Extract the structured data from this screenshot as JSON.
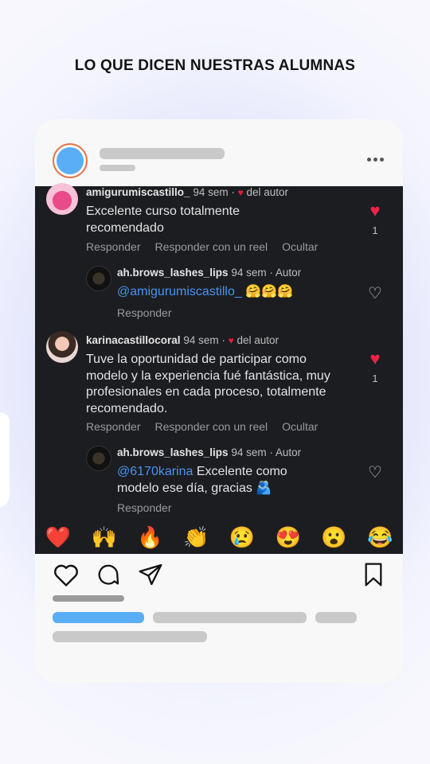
{
  "headline": "LO QUE DICEN NUESTRAS ALUMNAS",
  "post": {
    "comments": [
      {
        "username": "amigurumiscastillo_",
        "meta": "94 sem ·",
        "author_tag": "del autor",
        "text": "Excelente curso totalmente recomendado",
        "likes": "1",
        "actions": [
          "Responder",
          "Responder con un reel",
          "Ocultar"
        ]
      },
      {
        "username": "ah.brows_lashes_lips",
        "meta": "94 sem · Autor",
        "mention": "@amigurumiscastillo_",
        "text": " 🤗🤗🤗",
        "actions": [
          "Responder"
        ]
      },
      {
        "username": "karinacastillocoral",
        "meta": "94 sem ·",
        "author_tag": "del autor",
        "text": "Tuve la oportunidad de participar como modelo y la experiencia fué fantástica, muy profesionales en cada proceso, totalmente recomendado.",
        "likes": "1",
        "actions": [
          "Responder",
          "Responder con un reel",
          "Ocultar"
        ]
      },
      {
        "username": "ah.brows_lashes_lips",
        "meta": "94 sem · Autor",
        "mention": "@6170karina",
        "text": " Excelente como modelo ese día, gracias 🫂",
        "actions": [
          "Responder"
        ]
      }
    ],
    "emoji_bar": [
      "❤️",
      "🙌",
      "🔥",
      "👏",
      "😢",
      "😍",
      "😮",
      "😂"
    ]
  },
  "icons": {
    "heart": "heart-icon",
    "comment": "comment-icon",
    "share": "share-icon",
    "bookmark": "bookmark-icon",
    "more": "more-icon"
  },
  "colors": {
    "avatar_ring": "#e07446",
    "avatar_fill": "#5aaef6",
    "accent_bar": "#5aaef6",
    "like_red": "#ef2346",
    "mention_blue": "#4b93f0"
  }
}
